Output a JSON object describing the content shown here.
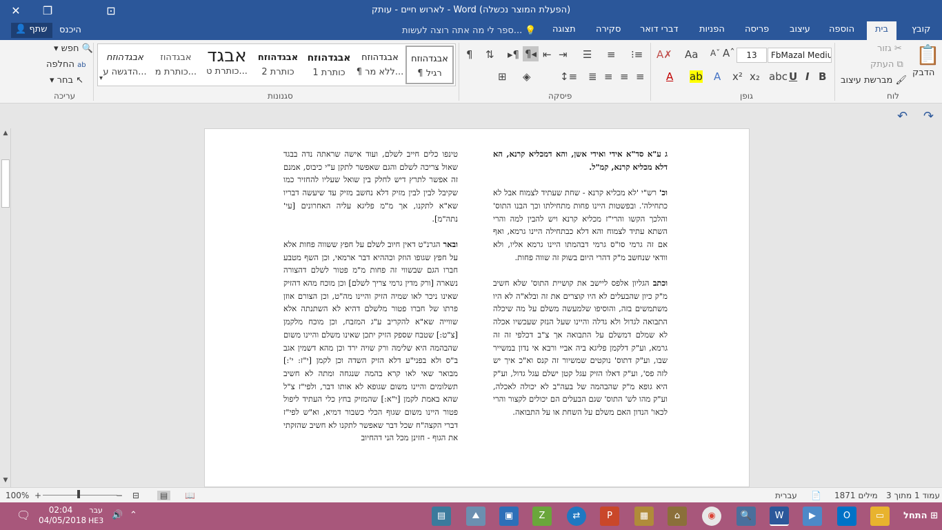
{
  "window": {
    "title": "לארוש חיים - עותק - Word (הפעלת המוצר נכשלה)",
    "close_icon": "✕",
    "restore_icon": "❐",
    "ribbon_display_icon": "⊡"
  },
  "tabs": [
    {
      "label": "קובץ"
    },
    {
      "label": "בית"
    },
    {
      "label": "הוספה"
    },
    {
      "label": "עיצוב"
    },
    {
      "label": "פריסה"
    },
    {
      "label": "הפניות"
    },
    {
      "label": "דברי דואר"
    },
    {
      "label": "סקירה"
    },
    {
      "label": "תצוגה"
    }
  ],
  "tell_me": "ספר לי מה אתה רוצה לעשות...",
  "sign_in": "היכנס",
  "share": "שתף",
  "ribbon": {
    "clipboard": {
      "label": "לוח",
      "paste": "הדבק",
      "cut": "גזור",
      "copy": "העתק",
      "format_painter": "מברשת עיצוב"
    },
    "font": {
      "label": "גופן",
      "font_name": "FbMazal Medium",
      "font_size": "13"
    },
    "paragraph": {
      "label": "פיסקה"
    },
    "styles": {
      "label": "סגנונות",
      "items": [
        {
          "preview": "אבגדהוזח",
          "name": "¶ רגיל"
        },
        {
          "preview": "אבגדהוזח",
          "name": "¶ ללא מר..."
        },
        {
          "preview": "אבגדהוזח",
          "name": "כותרת 1"
        },
        {
          "preview": "אבגדהוזח",
          "name": "כותרת 2"
        },
        {
          "preview": "אבגד",
          "name": "כותרת ט..."
        },
        {
          "preview": "אבגדהוז",
          "name": "כותרת מ..."
        },
        {
          "preview": "אבגדהוזח",
          "name": "הדגשה ע..."
        }
      ]
    },
    "editing": {
      "label": "עריכה",
      "find": "חפש",
      "replace": "החלפה",
      "select": "בחר"
    }
  },
  "document": {
    "right_column": [
      {
        "bold": "ג ע\"א סד\"א אידי ואידי אשן, והא דמכליא קרנא, הא דלא מכליא קרנא, קמ\"ל.",
        "text": ""
      },
      {
        "bold": "וכ'",
        "text": "רש\"י 'לא מכליא קרנא - שחת שעתיד לצמוח אבל לא כתחילה'. ובפשטות היינו פחות מתחילתו וכך הבנו התוס' והלכך הקשו והרי\"ז מכליא קרנא ויש להבין למה והרי השתא עתיד לצמוח והא דלא כבתחילה היינו גרמא, ואף אם זה גרמי סו\"ס גרמי דבהמתו היינו גרמא אליו, ולא וודאי שנחשב מ\"ק דהרי היום בשוק זה שווה פחות."
      },
      {
        "bold": "וכתב",
        "text": "הגליון אלפס ליישב את קושיית התוס' שלא חשיב מ\"ק כיון שהבעלים לא היו קוצרים את זה ובלא\"ה לא היו משתמשים בזה, והוסיפו שלמעשה משלם על מה שיכלה התבואה לגדול ולא גדלה והיינו שעל הנזק שעכשיו אכלה לא שמלם דמשלם על התבואה אך צ\"ב דכלפי זה זה גרמא, וע\"ק דלקמן פליגא ביה אביי ורבא אי נדון במשייר שבו, וע\"ק דתוס' נוקטים שמשיור זה קנס וא\"כ איך יש לזה פס', וע\"ק דאלו הזיק עגל קטן ישלם עגל גדול, וע\"ק היא גופא מ\"ק שהבהמה של בעה\"ב לא יכולה לאכלה, וע\"ק מהו לש' התוס' שגם הבעלים הם יכולים לקצור והרי לכאו' הנדון האם משלם על השחת או על התבואה."
      }
    ],
    "left_column": [
      {
        "bold": "",
        "text": "טינפו כלים חייב לשלם, ועוד אישה שראתה נדה בבגד שאול צריכה לשלם והגם שאפשר לתקן ע\"י כיבוס, אמנם זה אפשר לתרץ דיש לחלק בין שואל שעליו להחזיר כמו שקיבל לבין לבין מזיק דלא נחשב מזיק עד שיעשה דבריו שא\"א לתקנו, אך מ\"מ פליגא עליה האחרונים [עי' נתה\"מ]."
      },
      {
        "bold": "ובאר",
        "text": "הגרנ\"ט דאין חיוב לשלם על חפץ ששווה פחות אלא על חפץ שגופו הוזק וכההיא דבר ארמאי, וכן השף מטבע חברו הגם שבשווי זה פחות מ\"מ פטור לשלם דהצורה נשארה [ורק מדין גרמי צריך לשלם] וכן מוכח מהא דהזיק שאינו ניכר לאו שמיה הזיק והיינו מה\"ט, וכן הצורם אוזן פרתו של חברו פטור מלשלם דהיא לא השתנתה אלא שווייה שא\"א להקריב ע\"ג המזבח, וכן מוכח מלקמן [צ\"ט:] שטבח שספק הזיק יתכן שאינו משלם והיינו משום שהבהמה היא שלימה ורק שויה ירד וכן מהא דשמין אגב ב\"ס ולא בפני\"ע דלא הזיק השדה וכן לקמן [י\"ז: י':] מבואר שאי לאו קרא בהמה שנגחה ומתה לא חשיב תשלומים והיינו משום שגופא לא אותו דבר, ולפי\"ז צ\"ל שהא באמת לקמן [י\"א:] שהמזיק בחץ כלי העתיד ליפול פטור היינו משום שגוף הכלי כשבור דמיא, וא\"ש לפי\"ז דברי הקצה\"ח שכל דבר שאפשר לתקנו לא חשיב שהזקתי את הגוף - חזינן מכל הני דהחיוב"
      }
    ]
  },
  "status": {
    "page": "עמוד 1 מתוך 3",
    "words": "1871 מילים",
    "language": "עברית",
    "zoom": "100%"
  },
  "taskbar": {
    "start": "התחל",
    "time": "02:04",
    "date": "04/05/2018",
    "lang_top": "עבר",
    "lang_bottom": "HE3"
  }
}
